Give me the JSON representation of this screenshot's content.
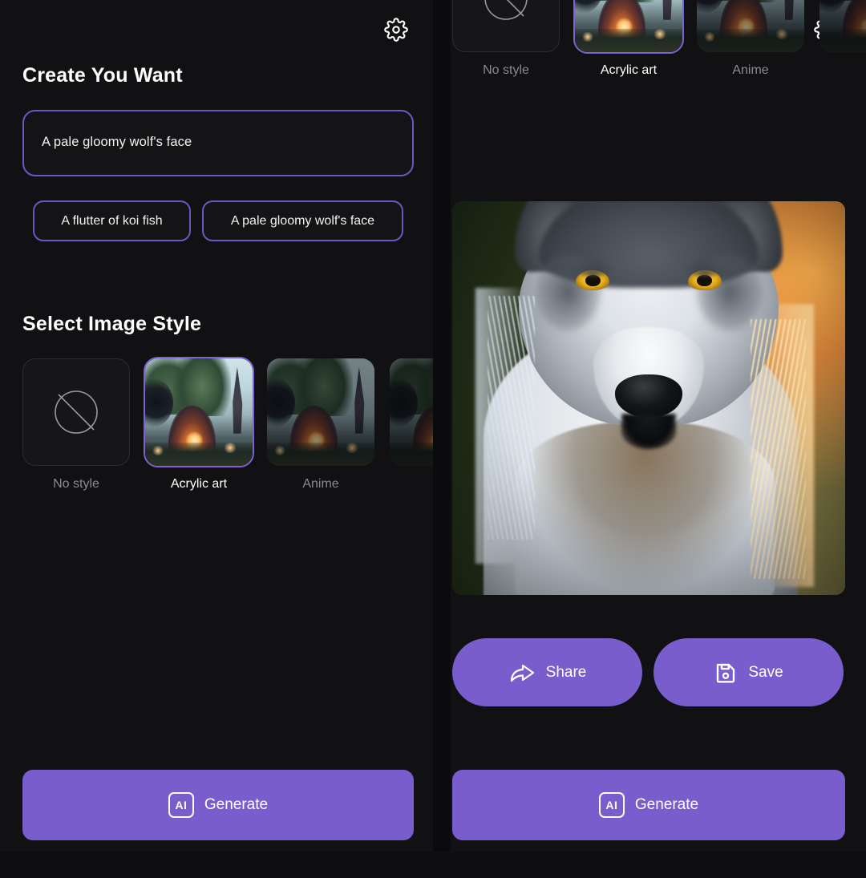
{
  "app": {
    "background_color": "#0b0b0d",
    "panel_color": "#111113",
    "accent_color": "#7a5dcc",
    "border_accent_color": "#6d55c4"
  },
  "left_screen": {
    "settings_icon": "gear-icon",
    "create_heading": "Create You Want",
    "prompt_input": {
      "value": "A pale gloomy wolf's face",
      "placeholder": "A pale gloomy wolf's face"
    },
    "suggestion_chips": [
      {
        "label": "A flutter of koi fish"
      },
      {
        "label": "A pale gloomy wolf's face"
      }
    ],
    "style_heading": "Select Image Style",
    "styles": [
      {
        "label": "No style",
        "selected": false,
        "icon": "no-style-icon"
      },
      {
        "label": "Acrylic art",
        "selected": true,
        "icon": ""
      },
      {
        "label": "Anime",
        "selected": false,
        "icon": ""
      },
      {
        "label": "",
        "selected": false,
        "icon": ""
      }
    ],
    "generate_button": {
      "label": "Generate",
      "badge": "AI"
    }
  },
  "right_screen": {
    "settings_icon": "gear-icon",
    "styles": [
      {
        "label": "No style",
        "selected": false,
        "icon": "no-style-icon"
      },
      {
        "label": "Acrylic art",
        "selected": true,
        "icon": ""
      },
      {
        "label": "Anime",
        "selected": false,
        "icon": ""
      },
      {
        "label": "",
        "selected": false,
        "icon": ""
      }
    ],
    "result_image": {
      "alt": "generated wolf face",
      "description": "Close-up of a pale gray and white wolf face with yellow eyes, backlit with warm orange rim light"
    },
    "share_button": {
      "label": "Share",
      "icon": "share-arrow-icon"
    },
    "save_button": {
      "label": "Save",
      "icon": "floppy-disk-icon"
    },
    "generate_button": {
      "label": "Generate",
      "badge": "AI"
    }
  }
}
